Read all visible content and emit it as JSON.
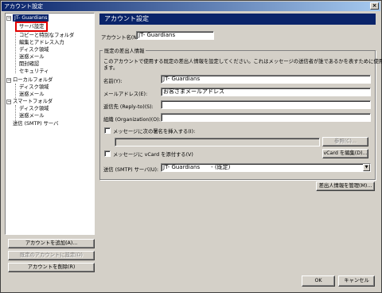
{
  "window": {
    "title": "アカウント設定",
    "close_glyph": "×"
  },
  "tree": {
    "account_name": "JT- Guardians",
    "items": [
      "サーバ設定",
      "コピーと特別なフォルダ",
      "編集とアドレス入力",
      "ディスク領域",
      "迷惑メール",
      "開封確認",
      "セキュリティ"
    ],
    "local_folders": "ローカルフォルダ",
    "local_items": [
      "ディスク領域",
      "迷惑メール"
    ],
    "smart_folders": "スマートフォルダ",
    "smart_items": [
      "ディスク領域",
      "迷惑メール"
    ],
    "smtp": "送信 (SMTP) サーバ",
    "expander_minus": "−"
  },
  "left_buttons": {
    "add": "アカウントを追加(A)...",
    "set_default": "既定のアカウントに設定(D)",
    "remove": "アカウントを削除(R)"
  },
  "main": {
    "title": "アカウント設定",
    "account_name_label": "アカウント名(N):",
    "account_name_value": "JT- Guardians",
    "group_title": "既定の差出人情報",
    "group_desc_1": "このアカウントで使用する既定の差出人情報を設定してください。これはメッセージの送信者が誰であるかを表すために使用され",
    "group_desc_2": "ます。",
    "name_label": "名前(Y):",
    "name_value": "JT- Guardians",
    "email_label": "メールアドレス(E):",
    "email_value": "お客さまメールアドレス",
    "reply_label": "返信先 (Reply-to)(S):",
    "reply_value": "",
    "org_label": "組織 (Organization)(O):",
    "org_value": "",
    "signature_check": "メッセージに次の署名を挿入する(I):",
    "signature_path": "",
    "browse": "参照(C)...",
    "vcard_check": "メッセージに vCard を添付する(V)",
    "vcard_edit": "vCard を編集(D)...",
    "smtp_label": "送信 (SMTP) サーバ(U):",
    "smtp_value": "JT- Guardians　　- (既定)",
    "select_arrow": "▼",
    "manage_identities": "差出人情報を管理(M)..."
  },
  "footer": {
    "ok": "OK",
    "cancel": "キャンセル"
  }
}
